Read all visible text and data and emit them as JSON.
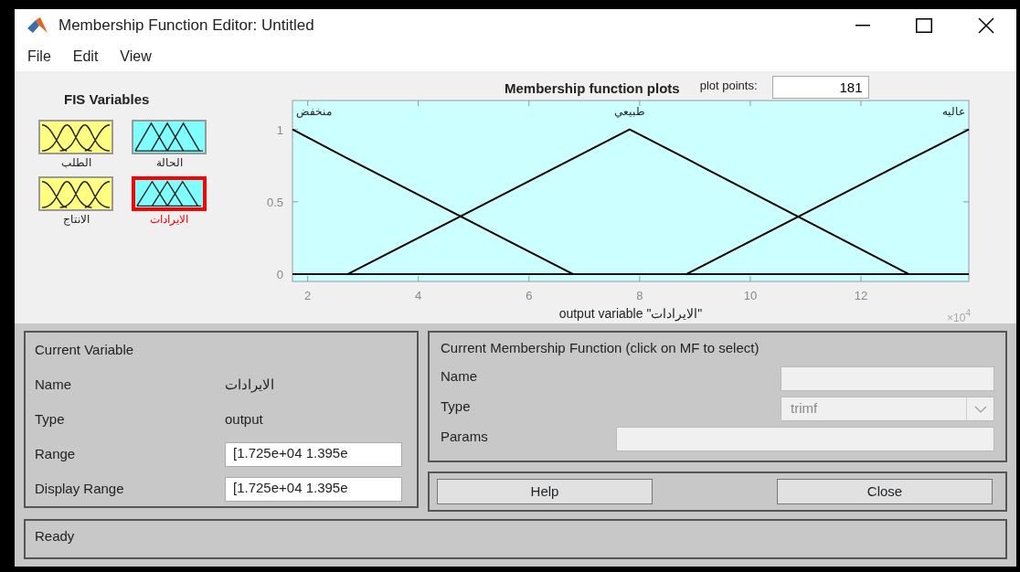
{
  "window": {
    "title": "Membership Function Editor: Untitled"
  },
  "menu": [
    "File",
    "Edit",
    "View"
  ],
  "fis_variables": {
    "title": "FIS Variables",
    "items": [
      {
        "name": "الطلب",
        "kind": "gaussian",
        "selected": false
      },
      {
        "name": "الحالة",
        "kind": "triangular",
        "selected": false
      },
      {
        "name": "الانتاج",
        "kind": "gaussian",
        "selected": false
      },
      {
        "name": "الايرادات",
        "kind": "triangular",
        "selected": true
      }
    ]
  },
  "plot_points": {
    "label": "plot points:",
    "value": "181"
  },
  "plot": {
    "chart_data": {
      "type": "line",
      "title": "Membership function plots",
      "xlabel": "output variable \"الايرادات\"",
      "x": [
        1.725,
        2.72,
        6.8,
        7.82,
        8.84,
        12.87,
        13.95
      ],
      "series": [
        {
          "name": "منخفض",
          "color": "#000000",
          "values": [
            1,
            0.8,
            0,
            null,
            null,
            null,
            null
          ]
        },
        {
          "name": "طبيعي",
          "color": "#000000",
          "values": [
            null,
            0,
            0.8,
            1,
            0.8,
            0,
            null
          ]
        },
        {
          "name": "عاليه",
          "color": "#000000",
          "values": [
            null,
            null,
            null,
            null,
            0,
            0.79,
            1
          ]
        }
      ],
      "xlim": [
        1.725,
        13.95
      ],
      "ylim": [
        -0.05,
        1.2
      ],
      "xticks": [
        2,
        4,
        6,
        8,
        10,
        12
      ],
      "yticks": [
        0,
        0.5,
        1
      ]
    },
    "axis_multiplier": {
      "base": "×10",
      "exponent": "4"
    }
  },
  "current_variable": {
    "title": "Current Variable",
    "rows": [
      {
        "label": "Name",
        "value": "الايرادات",
        "kind": "text"
      },
      {
        "label": "Type",
        "value": "output",
        "kind": "text"
      },
      {
        "label": "Range",
        "value": "[1.725e+04 1.395e",
        "kind": "field"
      },
      {
        "label": "Display Range",
        "value": "[1.725e+04 1.395e",
        "kind": "field"
      }
    ]
  },
  "current_mf": {
    "title": "Current Membership Function (click on MF to select)",
    "rows": [
      {
        "label": "Name",
        "kind": "field",
        "disabled": true
      },
      {
        "label": "Type",
        "kind": "select",
        "value": "trimf",
        "disabled": true
      },
      {
        "label": "Params",
        "kind": "wide_field",
        "disabled": true
      }
    ]
  },
  "buttons": [
    "Help",
    "Close"
  ],
  "status_bar": "Ready"
}
